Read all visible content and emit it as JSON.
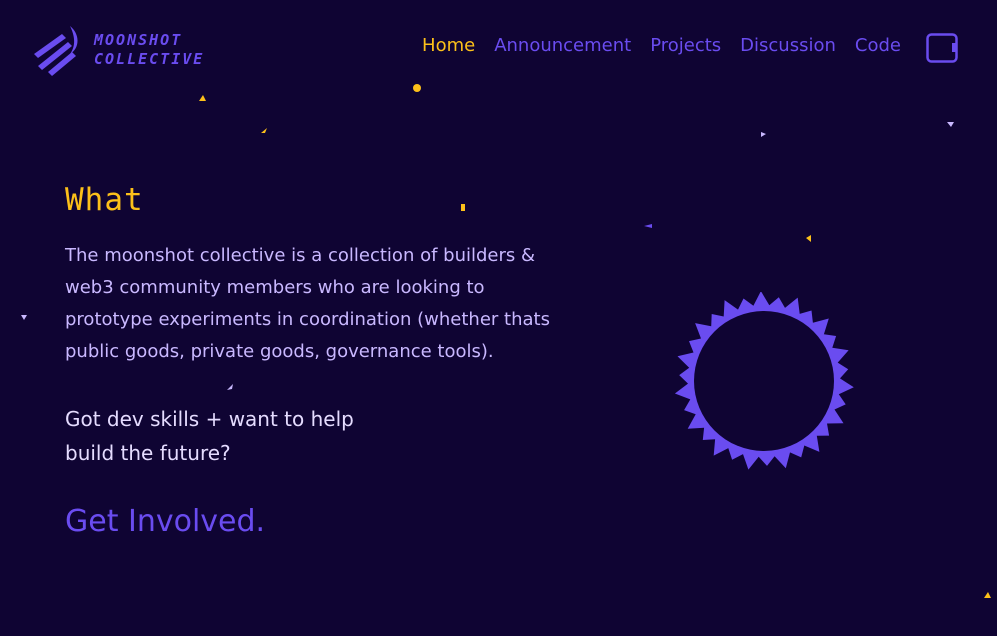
{
  "colors": {
    "background": "#0f0433",
    "accent_purple": "#6a4cf0",
    "accent_yellow": "#fcc01a",
    "text_light": "#c9b8ff"
  },
  "header": {
    "logo_line1": "MOONSHOT",
    "logo_line2": "COLLECTIVE",
    "logo_icon": "moonshot-comet-icon",
    "nav": [
      {
        "label": "Home",
        "active": true
      },
      {
        "label": "Announcement",
        "active": false
      },
      {
        "label": "Projects",
        "active": false
      },
      {
        "label": "Discussion",
        "active": false
      },
      {
        "label": "Code",
        "active": false
      }
    ],
    "wallet_icon": "wallet-icon"
  },
  "main": {
    "title": "What",
    "description": "The moonshot collective is a collection of builders & web3 community members who are looking to prototype experiments in coordination (whether thats public goods, private goods, governance tools).",
    "cta_text": "Got dev skills + want to help build the future?",
    "cta_link": "Get Involved."
  },
  "decoration": {
    "ring_icon": "spiky-ring-icon",
    "stars_icon": "sparkle-icon"
  }
}
